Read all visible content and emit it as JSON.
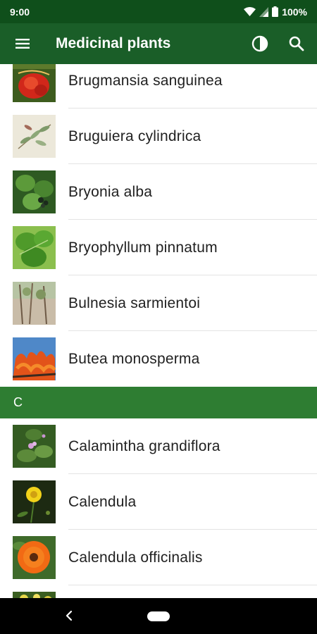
{
  "status_bar": {
    "time": "9:00",
    "battery": "100%"
  },
  "app_bar": {
    "title": "Medicinal plants"
  },
  "list": {
    "group_b": [
      {
        "name": "Brugmansia sanguinea",
        "thumb": "brugmansia"
      },
      {
        "name": "Bruguiera cylindrica",
        "thumb": "bruguiera"
      },
      {
        "name": "Bryonia alba",
        "thumb": "bryonia"
      },
      {
        "name": "Bryophyllum pinnatum",
        "thumb": "bryophyllum"
      },
      {
        "name": "Bulnesia sarmientoi",
        "thumb": "bulnesia"
      },
      {
        "name": "Butea monosperma",
        "thumb": "butea"
      }
    ],
    "section_c": {
      "letter": "C"
    },
    "group_c": [
      {
        "name": "Calamintha grandiflora",
        "thumb": "calamintha"
      },
      {
        "name": "Calendula",
        "thumb": "calendula"
      },
      {
        "name": "Calendula officinalis",
        "thumb": "calendula-officinalis"
      },
      {
        "name": "",
        "thumb": "partial"
      }
    ]
  },
  "colors": {
    "status_bar": "#0f4f1b",
    "app_bar": "#1a5e28",
    "section_header": "#2e7d32",
    "divider": "#e3e3e3"
  },
  "icons": [
    "menu-icon",
    "contrast-icon",
    "search-icon",
    "wifi-icon",
    "signal-icon",
    "battery-icon",
    "back-icon",
    "home-pill"
  ]
}
